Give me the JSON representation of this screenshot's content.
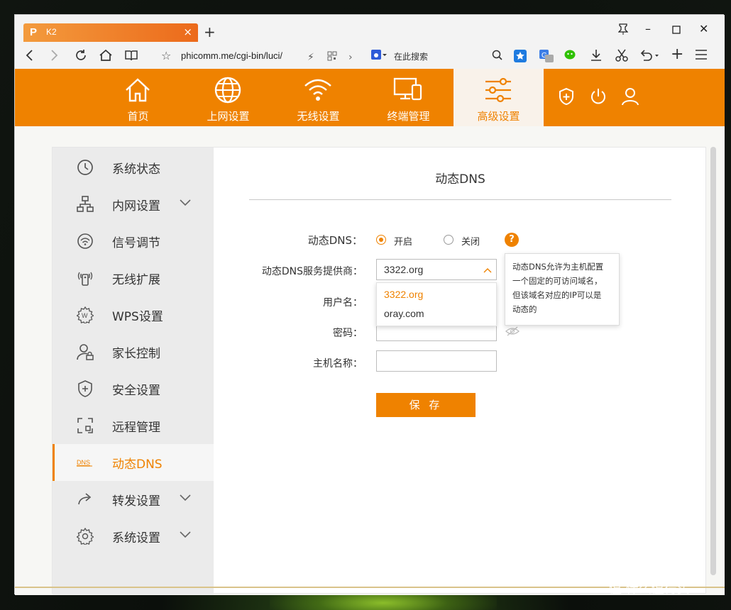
{
  "browser": {
    "tab_title": "K2",
    "tab_logo": "P",
    "address": "phicomm.me/cgi-bin/luci/",
    "search_placeholder": "在此搜索"
  },
  "topnav": {
    "items": [
      {
        "label": "首页",
        "icon": "home-icon"
      },
      {
        "label": "上网设置",
        "icon": "globe-icon"
      },
      {
        "label": "无线设置",
        "icon": "wifi-icon"
      },
      {
        "label": "终端管理",
        "icon": "devices-icon"
      },
      {
        "label": "高级设置",
        "icon": "sliders-icon",
        "active": true
      }
    ],
    "right_icons": [
      "shield-plus-icon",
      "power-icon",
      "user-icon"
    ]
  },
  "sidebar": {
    "items": [
      {
        "label": "系统状态",
        "icon": "clock-icon"
      },
      {
        "label": "内网设置",
        "icon": "network-icon",
        "expandable": true
      },
      {
        "label": "信号调节",
        "icon": "signal-icon"
      },
      {
        "label": "无线扩展",
        "icon": "extender-icon"
      },
      {
        "label": "WPS设置",
        "icon": "wps-gear-icon"
      },
      {
        "label": "家长控制",
        "icon": "parent-lock-icon"
      },
      {
        "label": "安全设置",
        "icon": "shield-icon"
      },
      {
        "label": "远程管理",
        "icon": "remote-icon"
      },
      {
        "label": "动态DNS",
        "icon": "dns-icon",
        "active": true
      },
      {
        "label": "转发设置",
        "icon": "forward-icon",
        "expandable": true
      },
      {
        "label": "系统设置",
        "icon": "settings-gear-icon",
        "expandable": true
      }
    ]
  },
  "main": {
    "title": "动态DNS",
    "ddns_label": "动态DNS：",
    "on_label": "开启",
    "off_label": "关闭",
    "help_icon": "?",
    "provider_label": "动态DNS服务提供商：",
    "provider_value": "3322.org",
    "provider_options": [
      "3322.org",
      "oray.com"
    ],
    "username_label": "用户名：",
    "password_label": "密码：",
    "hostname_label": "主机名称：",
    "save_label": "保 存",
    "tooltip_lines": [
      "动态DNS允许为主机配置",
      "一个固定的可访问域名，",
      "但该域名对应的IP可以是",
      "动态的"
    ]
  },
  "watermark": "值 什么值得买",
  "colors": {
    "accent": "#ef8200",
    "sidebar_bg": "#ebebeb"
  }
}
